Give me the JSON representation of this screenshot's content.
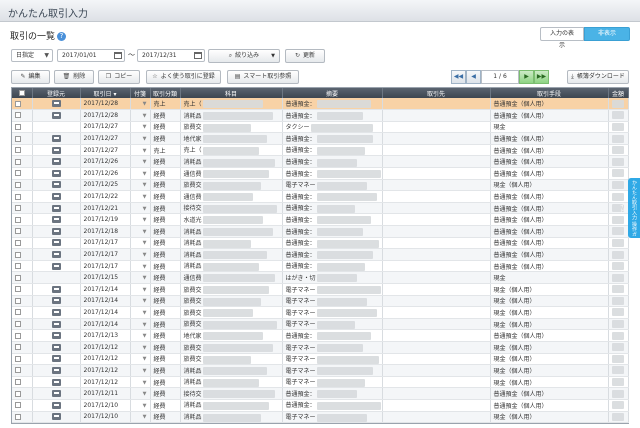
{
  "app": {
    "title": "かんたん取引入力"
  },
  "page": {
    "heading": "取引の一覧",
    "help_icon": "?"
  },
  "view_tabs": [
    {
      "label": "入力の表示"
    },
    {
      "label": "非表示"
    }
  ],
  "filter": {
    "date_mode": "日指定",
    "date_from": "2017/01/01",
    "date_to": "2017/12/31",
    "separator": "〜",
    "narrow_label": "絞り込み",
    "refresh_label": "更新"
  },
  "toolbar": {
    "edit": "編集",
    "delete": "削除",
    "copy": "コピー",
    "register_frequent": "よく使う取引に登録",
    "smart_ref": "スマート取引参照",
    "ledger_download": "帳簿ダウンロード"
  },
  "pager": {
    "first": "◀◀",
    "prev": "◀",
    "page": "1",
    "sep": "/",
    "total": "6",
    "next": "▶",
    "last": "▶▶"
  },
  "columns": [
    "",
    "登録元",
    "取引日 ▾",
    "付箋",
    "取引分類",
    "科目",
    "摘要",
    "取引先",
    "取引手段",
    "金額"
  ],
  "rows": [
    {
      "date": "2017/12/28",
      "type": "売上",
      "account": "売上（",
      "desc": "普通預金：",
      "method": "普通預金（個人用）",
      "icon": true,
      "selected": true
    },
    {
      "date": "2017/12/28",
      "type": "経費",
      "account": "消耗品",
      "desc": "普通預金：",
      "method": "普通預金（個人用）",
      "icon": true
    },
    {
      "date": "2017/12/27",
      "type": "経費",
      "account": "旅費交",
      "desc": "タクシー",
      "method": "現金",
      "icon": false
    },
    {
      "date": "2017/12/27",
      "type": "経費",
      "account": "地代家",
      "desc": "普通預金：",
      "method": "普通預金（個人用）",
      "icon": true
    },
    {
      "date": "2017/12/27",
      "type": "売上",
      "account": "売上（",
      "desc": "普通預金：",
      "method": "普通預金（個人用）",
      "icon": true
    },
    {
      "date": "2017/12/26",
      "type": "経費",
      "account": "消耗品",
      "desc": "普通預金：",
      "method": "普通預金（個人用）",
      "icon": true
    },
    {
      "date": "2017/12/26",
      "type": "経費",
      "account": "通信費",
      "desc": "普通預金：",
      "method": "普通預金（個人用）",
      "icon": true
    },
    {
      "date": "2017/12/25",
      "type": "経費",
      "account": "旅費交",
      "desc": "電子マネー",
      "method": "現金（個人用）",
      "icon": true
    },
    {
      "date": "2017/12/22",
      "type": "経費",
      "account": "通信費",
      "desc": "普通預金：",
      "method": "普通預金（個人用）",
      "icon": true
    },
    {
      "date": "2017/12/21",
      "type": "経費",
      "account": "接待交",
      "desc": "普通預金：",
      "method": "普通預金（個人用）",
      "icon": true
    },
    {
      "date": "2017/12/19",
      "type": "経費",
      "account": "水道光",
      "desc": "普通預金：",
      "method": "普通預金（個人用）",
      "icon": true
    },
    {
      "date": "2017/12/18",
      "type": "経費",
      "account": "消耗品",
      "desc": "普通預金：",
      "method": "普通預金（個人用）",
      "icon": true
    },
    {
      "date": "2017/12/17",
      "type": "経費",
      "account": "消耗品",
      "desc": "普通預金：",
      "method": "普通預金（個人用）",
      "icon": true
    },
    {
      "date": "2017/12/17",
      "type": "経費",
      "account": "消耗品",
      "desc": "普通預金：",
      "method": "普通預金（個人用）",
      "icon": true
    },
    {
      "date": "2017/12/17",
      "type": "経費",
      "account": "消耗品",
      "desc": "普通預金：",
      "method": "普通預金（個人用）",
      "icon": true
    },
    {
      "date": "2017/12/15",
      "type": "経費",
      "account": "通信費",
      "desc": "はがき・切",
      "method": "現金",
      "icon": false
    },
    {
      "date": "2017/12/14",
      "type": "経費",
      "account": "旅費交",
      "desc": "電子マネー",
      "method": "現金（個人用）",
      "icon": true
    },
    {
      "date": "2017/12/14",
      "type": "経費",
      "account": "旅費交",
      "desc": "電子マネー",
      "method": "現金（個人用）",
      "icon": true
    },
    {
      "date": "2017/12/14",
      "type": "経費",
      "account": "旅費交",
      "desc": "電子マネー",
      "method": "現金（個人用）",
      "icon": true
    },
    {
      "date": "2017/12/14",
      "type": "経費",
      "account": "旅費交",
      "desc": "電子マネー",
      "method": "現金（個人用）",
      "icon": true
    },
    {
      "date": "2017/12/13",
      "type": "経費",
      "account": "地代家",
      "desc": "普通預金：",
      "method": "普通預金（個人用）",
      "icon": true
    },
    {
      "date": "2017/12/12",
      "type": "経費",
      "account": "旅費交",
      "desc": "電子マネー",
      "method": "現金（個人用）",
      "icon": true
    },
    {
      "date": "2017/12/12",
      "type": "経費",
      "account": "旅費交",
      "desc": "電子マネー",
      "method": "現金（個人用）",
      "icon": true
    },
    {
      "date": "2017/12/12",
      "type": "経費",
      "account": "消耗品",
      "desc": "電子マネー",
      "method": "現金（個人用）",
      "icon": true
    },
    {
      "date": "2017/12/12",
      "type": "経費",
      "account": "消耗品",
      "desc": "電子マネー",
      "method": "現金（個人用）",
      "icon": true
    },
    {
      "date": "2017/12/11",
      "type": "経費",
      "account": "接待交",
      "desc": "普通預金：",
      "method": "普通預金（個人用）",
      "icon": true
    },
    {
      "date": "2017/12/10",
      "type": "経費",
      "account": "消耗品",
      "desc": "普通預金：",
      "method": "普通預金（個人用）",
      "icon": true
    },
    {
      "date": "2017/12/10",
      "type": "経費",
      "account": "消耗品",
      "desc": "電子マネー",
      "method": "現金（個人用）",
      "icon": true
    }
  ],
  "side_tab": {
    "label": "かんたん取引入力 操作ガイド"
  },
  "colors": {
    "accent": "#4ab3e6",
    "selected_row": "#f8d2a6",
    "header_bg": "#3c4550",
    "pager_green": "#8ed483"
  }
}
